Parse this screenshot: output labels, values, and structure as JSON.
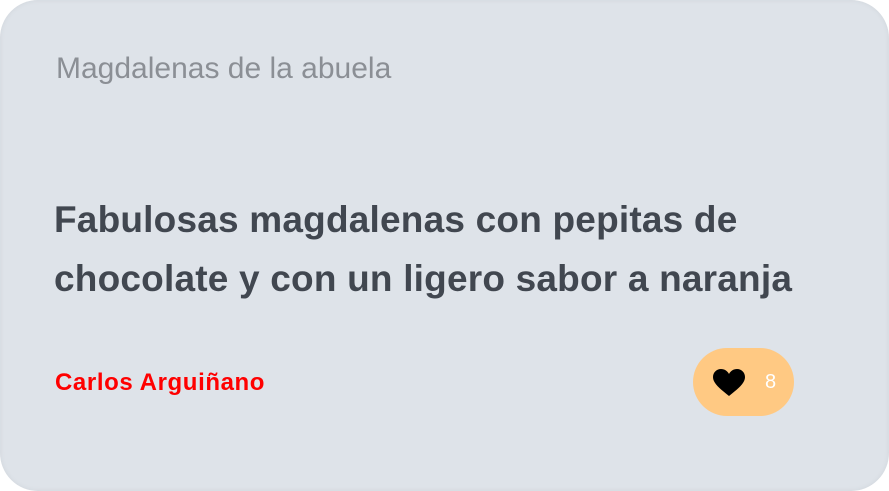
{
  "card": {
    "category": "Magdalenas de la abuela",
    "title": "Fabulosas magdalenas con pepitas de chocolate y con un ligero sabor a naranja",
    "author": "Carlos Arguiñano",
    "likes": {
      "icon": "heart-icon",
      "count": "8"
    }
  },
  "colors": {
    "card_background": "#dee3e9",
    "author": "#ff0000",
    "like_pill": "#ffc983",
    "title": "#414750",
    "category": "#8b8f95"
  }
}
